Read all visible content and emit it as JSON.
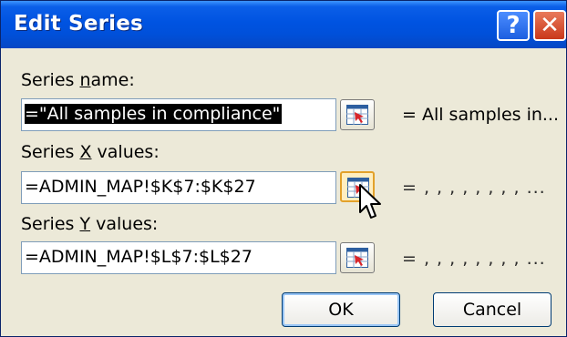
{
  "window": {
    "title": "Edit Series",
    "help_glyph": "?",
    "close_glyph": "✕"
  },
  "series_name": {
    "label_before": "Series ",
    "label_accel": "n",
    "label_after": "ame:",
    "value": "=\"All samples in compliance\"",
    "preview": "= All samples in..."
  },
  "series_x": {
    "label_before": "Series ",
    "label_accel": "X",
    "label_after": " values:",
    "value": "=ADMIN_MAP!$K$7:$K$27",
    "preview": "= , , , , , , , , ..."
  },
  "series_y": {
    "label_before": "Series ",
    "label_accel": "Y",
    "label_after": " values:",
    "value": "=ADMIN_MAP!$L$7:$L$27",
    "preview": "= , , , , , , , , ..."
  },
  "buttons": {
    "ok": "OK",
    "cancel": "Cancel"
  },
  "icons": {
    "range_selector": "range-select-icon",
    "cursor": "mouse-pointer-icon"
  },
  "colors": {
    "titlebar": "#0053e1",
    "dialog_bg": "#ece9d8",
    "close": "#c9381b",
    "field_border": "#7f9db9"
  }
}
